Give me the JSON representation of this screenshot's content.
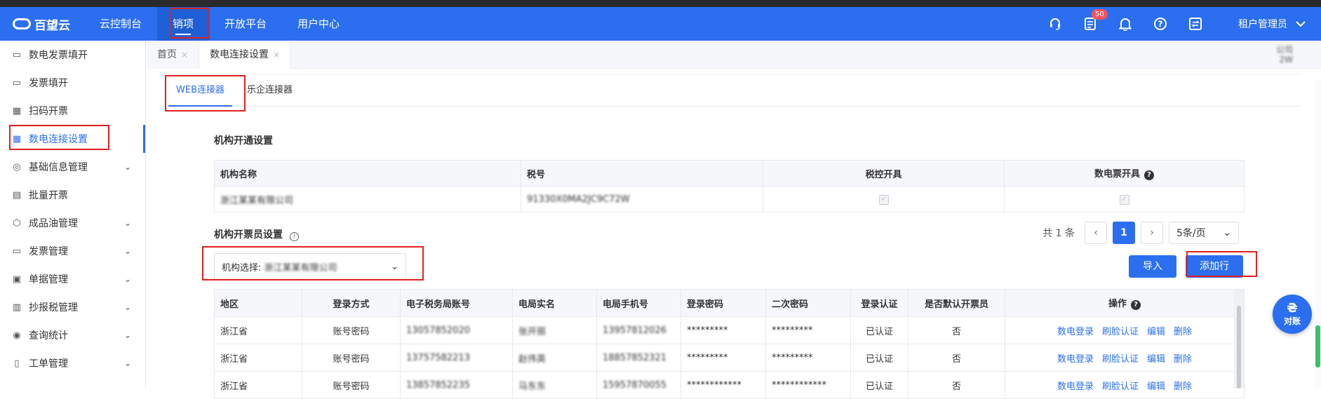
{
  "topbar": {
    "logo_text": "百望云",
    "nav": [
      "云控制台",
      "销项",
      "开放平台",
      "用户中心"
    ],
    "notification_count": "50",
    "user_name": "租户管理员"
  },
  "sidebar": {
    "items": [
      {
        "label": "数电发票填开"
      },
      {
        "label": "发票填开"
      },
      {
        "label": "扫码开票"
      },
      {
        "label": "数电连接设置"
      },
      {
        "label": "基础信息管理"
      },
      {
        "label": "批量开票"
      },
      {
        "label": "成品油管理"
      },
      {
        "label": "发票管理"
      },
      {
        "label": "单据管理"
      },
      {
        "label": "抄报税管理"
      },
      {
        "label": "查询统计"
      },
      {
        "label": "工单管理"
      }
    ]
  },
  "page_tabs": {
    "home": "首页",
    "current": "数电连接设置",
    "close": "×"
  },
  "top_right_info": {
    "line1": "公司",
    "line2": "2W"
  },
  "connector_tabs": [
    "WEB连接器",
    "乐企连接器"
  ],
  "org_section": {
    "title": "机构开通设置",
    "headers": [
      "机构名称",
      "税号",
      "税控开具",
      "数电票开具"
    ],
    "row": {
      "name": "浙江某某有限公司",
      "tax_no": "91330X0MA2JC9C72W"
    }
  },
  "issuer_section": {
    "title": "机构开票员设置",
    "total_text": "共 1 条",
    "current_page": "1",
    "page_size": "5条/页",
    "org_select_label": "机构选择:",
    "org_select_value": "浙江某某有限公司",
    "import_label": "导入",
    "add_row_label": "添加行"
  },
  "issuer_table": {
    "headers": [
      "地区",
      "登录方式",
      "电子税务局账号",
      "电局实名",
      "电局手机号",
      "登录密码",
      "二次密码",
      "登录认证",
      "是否默认开票员",
      "操作"
    ],
    "actions": [
      "数电登录",
      "刷脸认证",
      "编辑",
      "删除"
    ],
    "rows": [
      [
        "浙江省",
        "账号密码",
        "13057852020",
        "张开丽",
        "13957812026",
        "*********",
        "*********",
        "已认证",
        "否"
      ],
      [
        "浙江省",
        "账号密码",
        "13757582213",
        "赵伟英",
        "18857852321",
        "*********",
        "*********",
        "已认证",
        "否"
      ],
      [
        "浙江省",
        "账号密码",
        "13857852235",
        "马东东",
        "15957870055",
        "************",
        "************",
        "已认证",
        "否"
      ]
    ]
  },
  "float_button": {
    "label": "对账",
    "icon_text": "₴"
  }
}
